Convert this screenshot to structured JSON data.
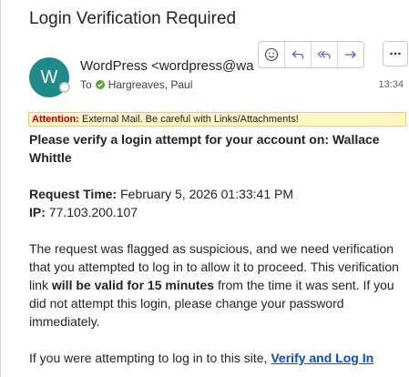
{
  "email": {
    "subject": "Login Verification Required",
    "avatar_initial": "W",
    "sender": "WordPress <wordpress@wa",
    "to_label": "To",
    "recipient": "Hargreaves, Paul",
    "time": "13:34"
  },
  "toolbar": {
    "icons": [
      "emoji-icon",
      "reply-icon",
      "reply-all-icon",
      "forward-icon",
      "more-icon"
    ]
  },
  "banner": {
    "label": "Attention:",
    "text": " External Mail. Be careful with Links/Attachments!"
  },
  "body": {
    "heading": "Please verify a login attempt for your account on: Wallace Whittle",
    "request_label": "Request Time:",
    "request_value": " February 5, 2026 01:33:41 PM",
    "ip_label": "IP:",
    "ip_value": " 77.103.200.107",
    "p1_start": "The request was flagged as suspicious, and we need verification that you attempted to log in to allow it to proceed. This verification link ",
    "p1_bold": "will be valid for 15 minutes",
    "p1_end": " from the time it was sent. If you did not attempt this login, please change your password immediately.",
    "p2_start": "If you were attempting to log in to this site, ",
    "link": "Verify and Log In"
  },
  "colors": {
    "avatar": "#1f8a8a",
    "banner_bg": "#fff6c0",
    "attention": "#c00000",
    "link": "#0b4cc7",
    "accent": "#5b5fc7"
  }
}
